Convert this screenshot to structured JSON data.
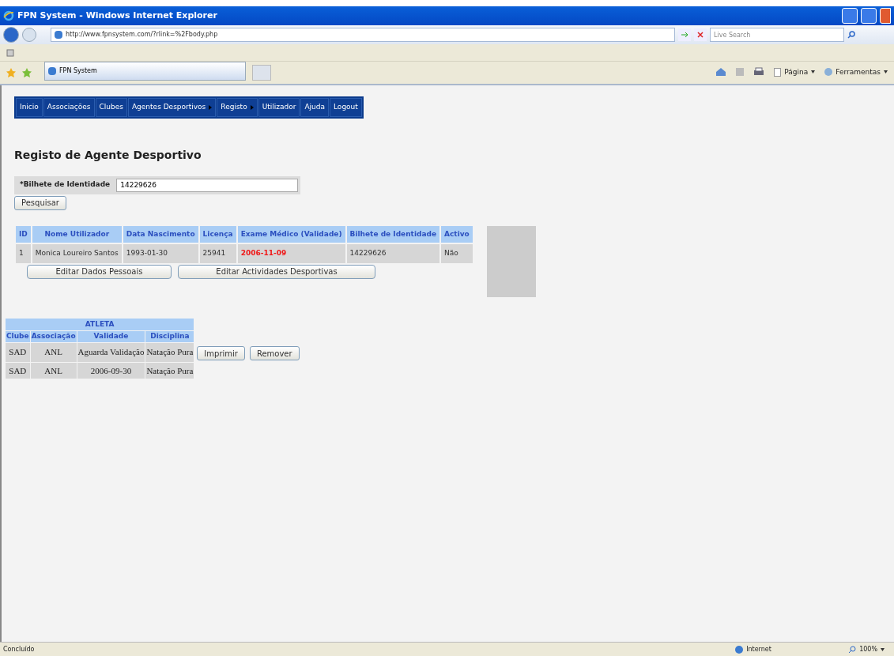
{
  "window": {
    "title": "FPN System - Windows Internet Explorer"
  },
  "address_bar": {
    "url": "http://www.fpnsystem.com/?rlink=%2Fbody.php"
  },
  "search": {
    "placeholder": "Live Search"
  },
  "tab": {
    "title": "FPN System"
  },
  "command_bar": [
    "Página",
    "Ferramentas"
  ],
  "nav": [
    {
      "label": "Inicio",
      "has_submenu": false
    },
    {
      "label": "Associações",
      "has_submenu": false
    },
    {
      "label": "Clubes",
      "has_submenu": false
    },
    {
      "label": "Agentes Desportivos",
      "has_submenu": true
    },
    {
      "label": "Registo",
      "has_submenu": true
    },
    {
      "label": "Utilizador",
      "has_submenu": false
    },
    {
      "label": "Ajuda",
      "has_submenu": false
    },
    {
      "label": "Logout",
      "has_submenu": false
    }
  ],
  "page_title": "Registo de Agente Desportivo",
  "id_field": {
    "label": "*Bilhete de Identidade",
    "value": "14229626"
  },
  "search_button": "Pesquisar",
  "agent_table": {
    "columns": [
      "ID",
      "Nome Utilizador",
      "Data Nascimento",
      "Licença",
      "Exame Médico (Validade)",
      "Bilhete de Identidade",
      "Activo"
    ],
    "rows": [
      {
        "id": "1",
        "name": "Monica Loureiro Santos",
        "birth": "1993-01-30",
        "license": "25941",
        "exam": "2006-11-09",
        "exam_expired": true,
        "id_card": "14229626",
        "active": "Não"
      }
    ]
  },
  "agent_buttons": [
    "Editar Dados Pessoais",
    "Editar Actividades Desportivas"
  ],
  "athlete_table": {
    "group": "ATLETA",
    "columns": [
      "Clube",
      "Associação",
      "Validade",
      "Disciplina"
    ],
    "rows": [
      {
        "cells": [
          "SAD",
          "ANL",
          "Aguarda Validação",
          "Natação Pura"
        ],
        "actions": [
          "Imprimir",
          "Remover"
        ]
      },
      {
        "cells": [
          "SAD",
          "ANL",
          "2006-09-30",
          "Natação Pura"
        ],
        "actions": []
      }
    ]
  },
  "status_bar": {
    "status": "Concluído",
    "zone": "Internet",
    "zoom": "100%"
  }
}
